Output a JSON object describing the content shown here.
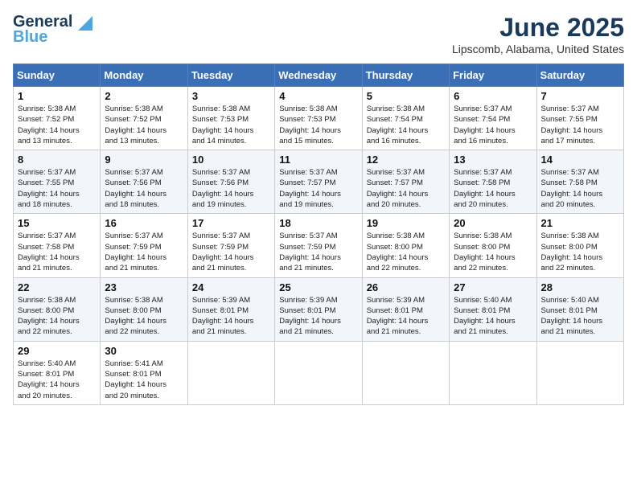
{
  "header": {
    "logo_line1": "General",
    "logo_line2": "Blue",
    "month": "June 2025",
    "location": "Lipscomb, Alabama, United States"
  },
  "weekdays": [
    "Sunday",
    "Monday",
    "Tuesday",
    "Wednesday",
    "Thursday",
    "Friday",
    "Saturday"
  ],
  "weeks": [
    [
      {
        "day": "1",
        "info": "Sunrise: 5:38 AM\nSunset: 7:52 PM\nDaylight: 14 hours\nand 13 minutes."
      },
      {
        "day": "2",
        "info": "Sunrise: 5:38 AM\nSunset: 7:52 PM\nDaylight: 14 hours\nand 13 minutes."
      },
      {
        "day": "3",
        "info": "Sunrise: 5:38 AM\nSunset: 7:53 PM\nDaylight: 14 hours\nand 14 minutes."
      },
      {
        "day": "4",
        "info": "Sunrise: 5:38 AM\nSunset: 7:53 PM\nDaylight: 14 hours\nand 15 minutes."
      },
      {
        "day": "5",
        "info": "Sunrise: 5:38 AM\nSunset: 7:54 PM\nDaylight: 14 hours\nand 16 minutes."
      },
      {
        "day": "6",
        "info": "Sunrise: 5:37 AM\nSunset: 7:54 PM\nDaylight: 14 hours\nand 16 minutes."
      },
      {
        "day": "7",
        "info": "Sunrise: 5:37 AM\nSunset: 7:55 PM\nDaylight: 14 hours\nand 17 minutes."
      }
    ],
    [
      {
        "day": "8",
        "info": "Sunrise: 5:37 AM\nSunset: 7:55 PM\nDaylight: 14 hours\nand 18 minutes."
      },
      {
        "day": "9",
        "info": "Sunrise: 5:37 AM\nSunset: 7:56 PM\nDaylight: 14 hours\nand 18 minutes."
      },
      {
        "day": "10",
        "info": "Sunrise: 5:37 AM\nSunset: 7:56 PM\nDaylight: 14 hours\nand 19 minutes."
      },
      {
        "day": "11",
        "info": "Sunrise: 5:37 AM\nSunset: 7:57 PM\nDaylight: 14 hours\nand 19 minutes."
      },
      {
        "day": "12",
        "info": "Sunrise: 5:37 AM\nSunset: 7:57 PM\nDaylight: 14 hours\nand 20 minutes."
      },
      {
        "day": "13",
        "info": "Sunrise: 5:37 AM\nSunset: 7:58 PM\nDaylight: 14 hours\nand 20 minutes."
      },
      {
        "day": "14",
        "info": "Sunrise: 5:37 AM\nSunset: 7:58 PM\nDaylight: 14 hours\nand 20 minutes."
      }
    ],
    [
      {
        "day": "15",
        "info": "Sunrise: 5:37 AM\nSunset: 7:58 PM\nDaylight: 14 hours\nand 21 minutes."
      },
      {
        "day": "16",
        "info": "Sunrise: 5:37 AM\nSunset: 7:59 PM\nDaylight: 14 hours\nand 21 minutes."
      },
      {
        "day": "17",
        "info": "Sunrise: 5:37 AM\nSunset: 7:59 PM\nDaylight: 14 hours\nand 21 minutes."
      },
      {
        "day": "18",
        "info": "Sunrise: 5:37 AM\nSunset: 7:59 PM\nDaylight: 14 hours\nand 21 minutes."
      },
      {
        "day": "19",
        "info": "Sunrise: 5:38 AM\nSunset: 8:00 PM\nDaylight: 14 hours\nand 22 minutes."
      },
      {
        "day": "20",
        "info": "Sunrise: 5:38 AM\nSunset: 8:00 PM\nDaylight: 14 hours\nand 22 minutes."
      },
      {
        "day": "21",
        "info": "Sunrise: 5:38 AM\nSunset: 8:00 PM\nDaylight: 14 hours\nand 22 minutes."
      }
    ],
    [
      {
        "day": "22",
        "info": "Sunrise: 5:38 AM\nSunset: 8:00 PM\nDaylight: 14 hours\nand 22 minutes."
      },
      {
        "day": "23",
        "info": "Sunrise: 5:38 AM\nSunset: 8:00 PM\nDaylight: 14 hours\nand 22 minutes."
      },
      {
        "day": "24",
        "info": "Sunrise: 5:39 AM\nSunset: 8:01 PM\nDaylight: 14 hours\nand 21 minutes."
      },
      {
        "day": "25",
        "info": "Sunrise: 5:39 AM\nSunset: 8:01 PM\nDaylight: 14 hours\nand 21 minutes."
      },
      {
        "day": "26",
        "info": "Sunrise: 5:39 AM\nSunset: 8:01 PM\nDaylight: 14 hours\nand 21 minutes."
      },
      {
        "day": "27",
        "info": "Sunrise: 5:40 AM\nSunset: 8:01 PM\nDaylight: 14 hours\nand 21 minutes."
      },
      {
        "day": "28",
        "info": "Sunrise: 5:40 AM\nSunset: 8:01 PM\nDaylight: 14 hours\nand 21 minutes."
      }
    ],
    [
      {
        "day": "29",
        "info": "Sunrise: 5:40 AM\nSunset: 8:01 PM\nDaylight: 14 hours\nand 20 minutes."
      },
      {
        "day": "30",
        "info": "Sunrise: 5:41 AM\nSunset: 8:01 PM\nDaylight: 14 hours\nand 20 minutes."
      },
      {
        "day": "",
        "info": ""
      },
      {
        "day": "",
        "info": ""
      },
      {
        "day": "",
        "info": ""
      },
      {
        "day": "",
        "info": ""
      },
      {
        "day": "",
        "info": ""
      }
    ]
  ]
}
